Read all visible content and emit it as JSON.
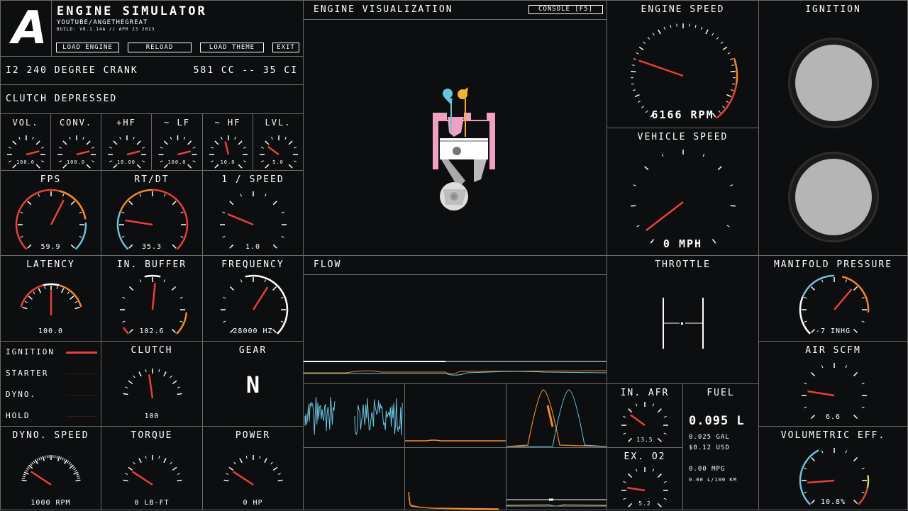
{
  "header": {
    "logo": "A",
    "title": "ENGINE SIMULATOR",
    "subtitle": "YOUTUBE/ANGETHEGREAT",
    "build": "BUILD: V0.1.14A // APR 23 2023",
    "buttons": [
      "LOAD ENGINE",
      "RELOAD",
      "LOAD THEME",
      "EXIT"
    ]
  },
  "engine_info": {
    "name": "I2 240 DEGREE CRANK",
    "displacement": "581 CC -- 35 CI"
  },
  "clutch_status": "CLUTCH DEPRESSED",
  "visualization": {
    "title": "ENGINE VISUALIZATION",
    "console_button": "CONSOLE [F5]"
  },
  "small_gauges": [
    {
      "label": "VOL.",
      "value": "100.0",
      "level": 0.78
    },
    {
      "label": "CONV.",
      "value": "100.0",
      "level": 0.78
    },
    {
      "label": "+HF",
      "value": "10.00",
      "level": 0.78
    },
    {
      "label": "~ LF",
      "value": "100.0",
      "level": 0.78
    },
    {
      "label": "~ HF",
      "value": "10.0",
      "level": 0.45
    },
    {
      "label": "LVL.",
      "value": "5.0",
      "level": 0.3
    }
  ],
  "gauges": {
    "fps": {
      "label": "FPS",
      "value": "59.9",
      "level": 0.6
    },
    "rtdt": {
      "label": "RT/DT",
      "value": "35.3",
      "level": 0.2
    },
    "inv_speed": {
      "label": "1 / SPEED",
      "value": "1.0",
      "level": 0.25
    },
    "latency": {
      "label": "LATENCY",
      "value": "100.0",
      "level": 0.5
    },
    "in_buffer": {
      "label": "IN. BUFFER",
      "value": "102.6",
      "level": 0.52
    },
    "frequency": {
      "label": "FREQUENCY",
      "value": "28000 HZ",
      "level": 0.62
    },
    "clutch": {
      "label": "CLUTCH",
      "value": "100",
      "level": 0.45
    },
    "dyno_speed": {
      "label": "DYNO. SPEED",
      "value": "1000 RPM",
      "level": 0.15
    },
    "torque": {
      "label": "TORQUE",
      "value": "0 LB-FT",
      "level": 0.15
    },
    "power": {
      "label": "POWER",
      "value": "0 HP",
      "level": 0.15
    },
    "engine_speed": {
      "label": "ENGINE SPEED",
      "value": "6166 RPM",
      "level": 0.25
    },
    "vehicle_speed": {
      "label": "VEHICLE SPEED",
      "value": "0 MPH",
      "level": 0.05
    },
    "manifold_pressure": {
      "label": "MANIFOLD PRESSURE",
      "value": "-7 INHG",
      "level": 0.65
    },
    "air_scfm": {
      "label": "AIR SCFM",
      "value": "6.6",
      "level": 0.2
    },
    "volumetric_eff": {
      "label": "VOLUMETRIC EFF.",
      "value": "10.8%",
      "level": 0.15
    },
    "in_afr": {
      "label": "IN. AFR",
      "value": "13.5",
      "level": 0.3
    },
    "ex_o2": {
      "label": "EX. O2",
      "value": "5.2",
      "level": 0.2
    }
  },
  "toggles": {
    "ignition": {
      "label": "IGNITION",
      "on": true
    },
    "starter": {
      "label": "STARTER",
      "on": false
    },
    "dyno": {
      "label": "DYNO.",
      "on": false
    },
    "hold": {
      "label": "HOLD",
      "on": false
    }
  },
  "gear": {
    "label": "GEAR",
    "value": "N"
  },
  "flow": {
    "title": "FLOW"
  },
  "throttle": {
    "title": "THROTTLE"
  },
  "ignition_panel": {
    "title": "IGNITION"
  },
  "fuel": {
    "title": "FUEL",
    "liters": "0.095 L",
    "gallons": "0.025 GAL",
    "cost": "$0.12 USD",
    "mpg": "0.00 MPG",
    "l100": "0.00 L/100 KM"
  },
  "colors": {
    "accent_red": "#e8403a",
    "accent_orange": "#f08a2a",
    "accent_blue": "#6cc3dc",
    "border": "#6a6a6a"
  }
}
